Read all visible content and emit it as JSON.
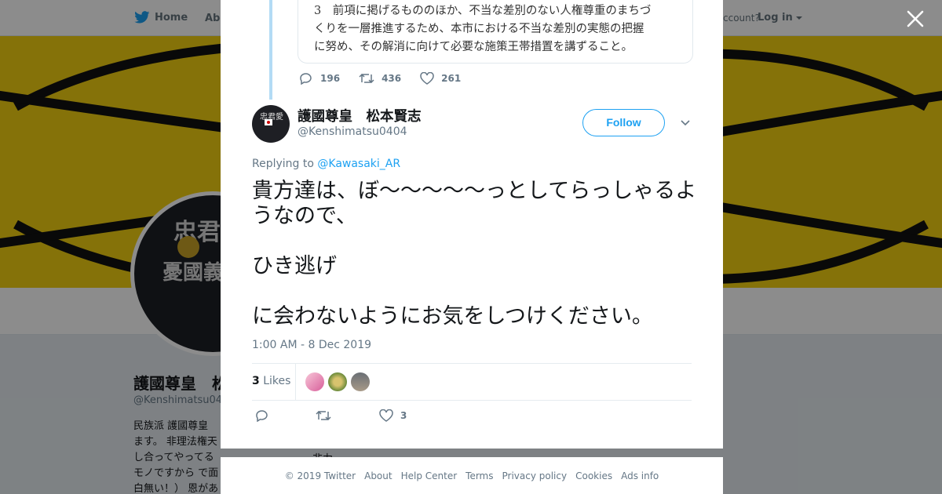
{
  "background": {
    "nav": {
      "home": "Home",
      "about": "Abo",
      "account_prompt": "ccount?",
      "login": "Log in"
    },
    "profile": {
      "name": "護國尊皇　松",
      "handle": "@Kenshimatsu040",
      "bio": "民族派 護國尊皇 ます。 非理法権天 し合ってやってるモノですから で面白無い！） 恩があります！！",
      "avatar_text": [
        "忠君愛",
        "憂國義"
      ],
      "bio_fragment": "非力"
    },
    "banner_colors": {
      "yellow": "#f3cf12",
      "black": "#111111"
    }
  },
  "quoted_tweet": {
    "text": "3　前項に掲げるもののほか、不当な差別のない人権尊重のまちづ\nくりを一層推進するため、本市における不当な差別の実態の把握\nに努め、その解消に向けて必要な施策王帯措置を講ずること。",
    "replies": "196",
    "retweets": "436",
    "likes": "261"
  },
  "tweet": {
    "author_name": "護國尊皇　松本賢志",
    "author_handle": "@Kenshimatsu0404",
    "follow_label": "Follow",
    "replying_prefix": "Replying to",
    "replying_to": "@Kawasaki_AR",
    "text": "貴方達は、ぼ～～～～～っとしてらっしゃるようなので、\n\nひき逃げ\n\nに会わないようにお気をしつけください。",
    "timestamp": "1:00 AM - 8 Dec 2019",
    "likes_count": "3",
    "likes_label": "Likes",
    "action_like_count": "3"
  },
  "footer": [
    "© 2019 Twitter",
    "About",
    "Help Center",
    "Terms",
    "Privacy policy",
    "Cookies",
    "Ads info"
  ],
  "colors": {
    "accent": "#1da1f2",
    "muted": "#657786",
    "text": "#14171a",
    "thread": "#b3dbf5"
  }
}
